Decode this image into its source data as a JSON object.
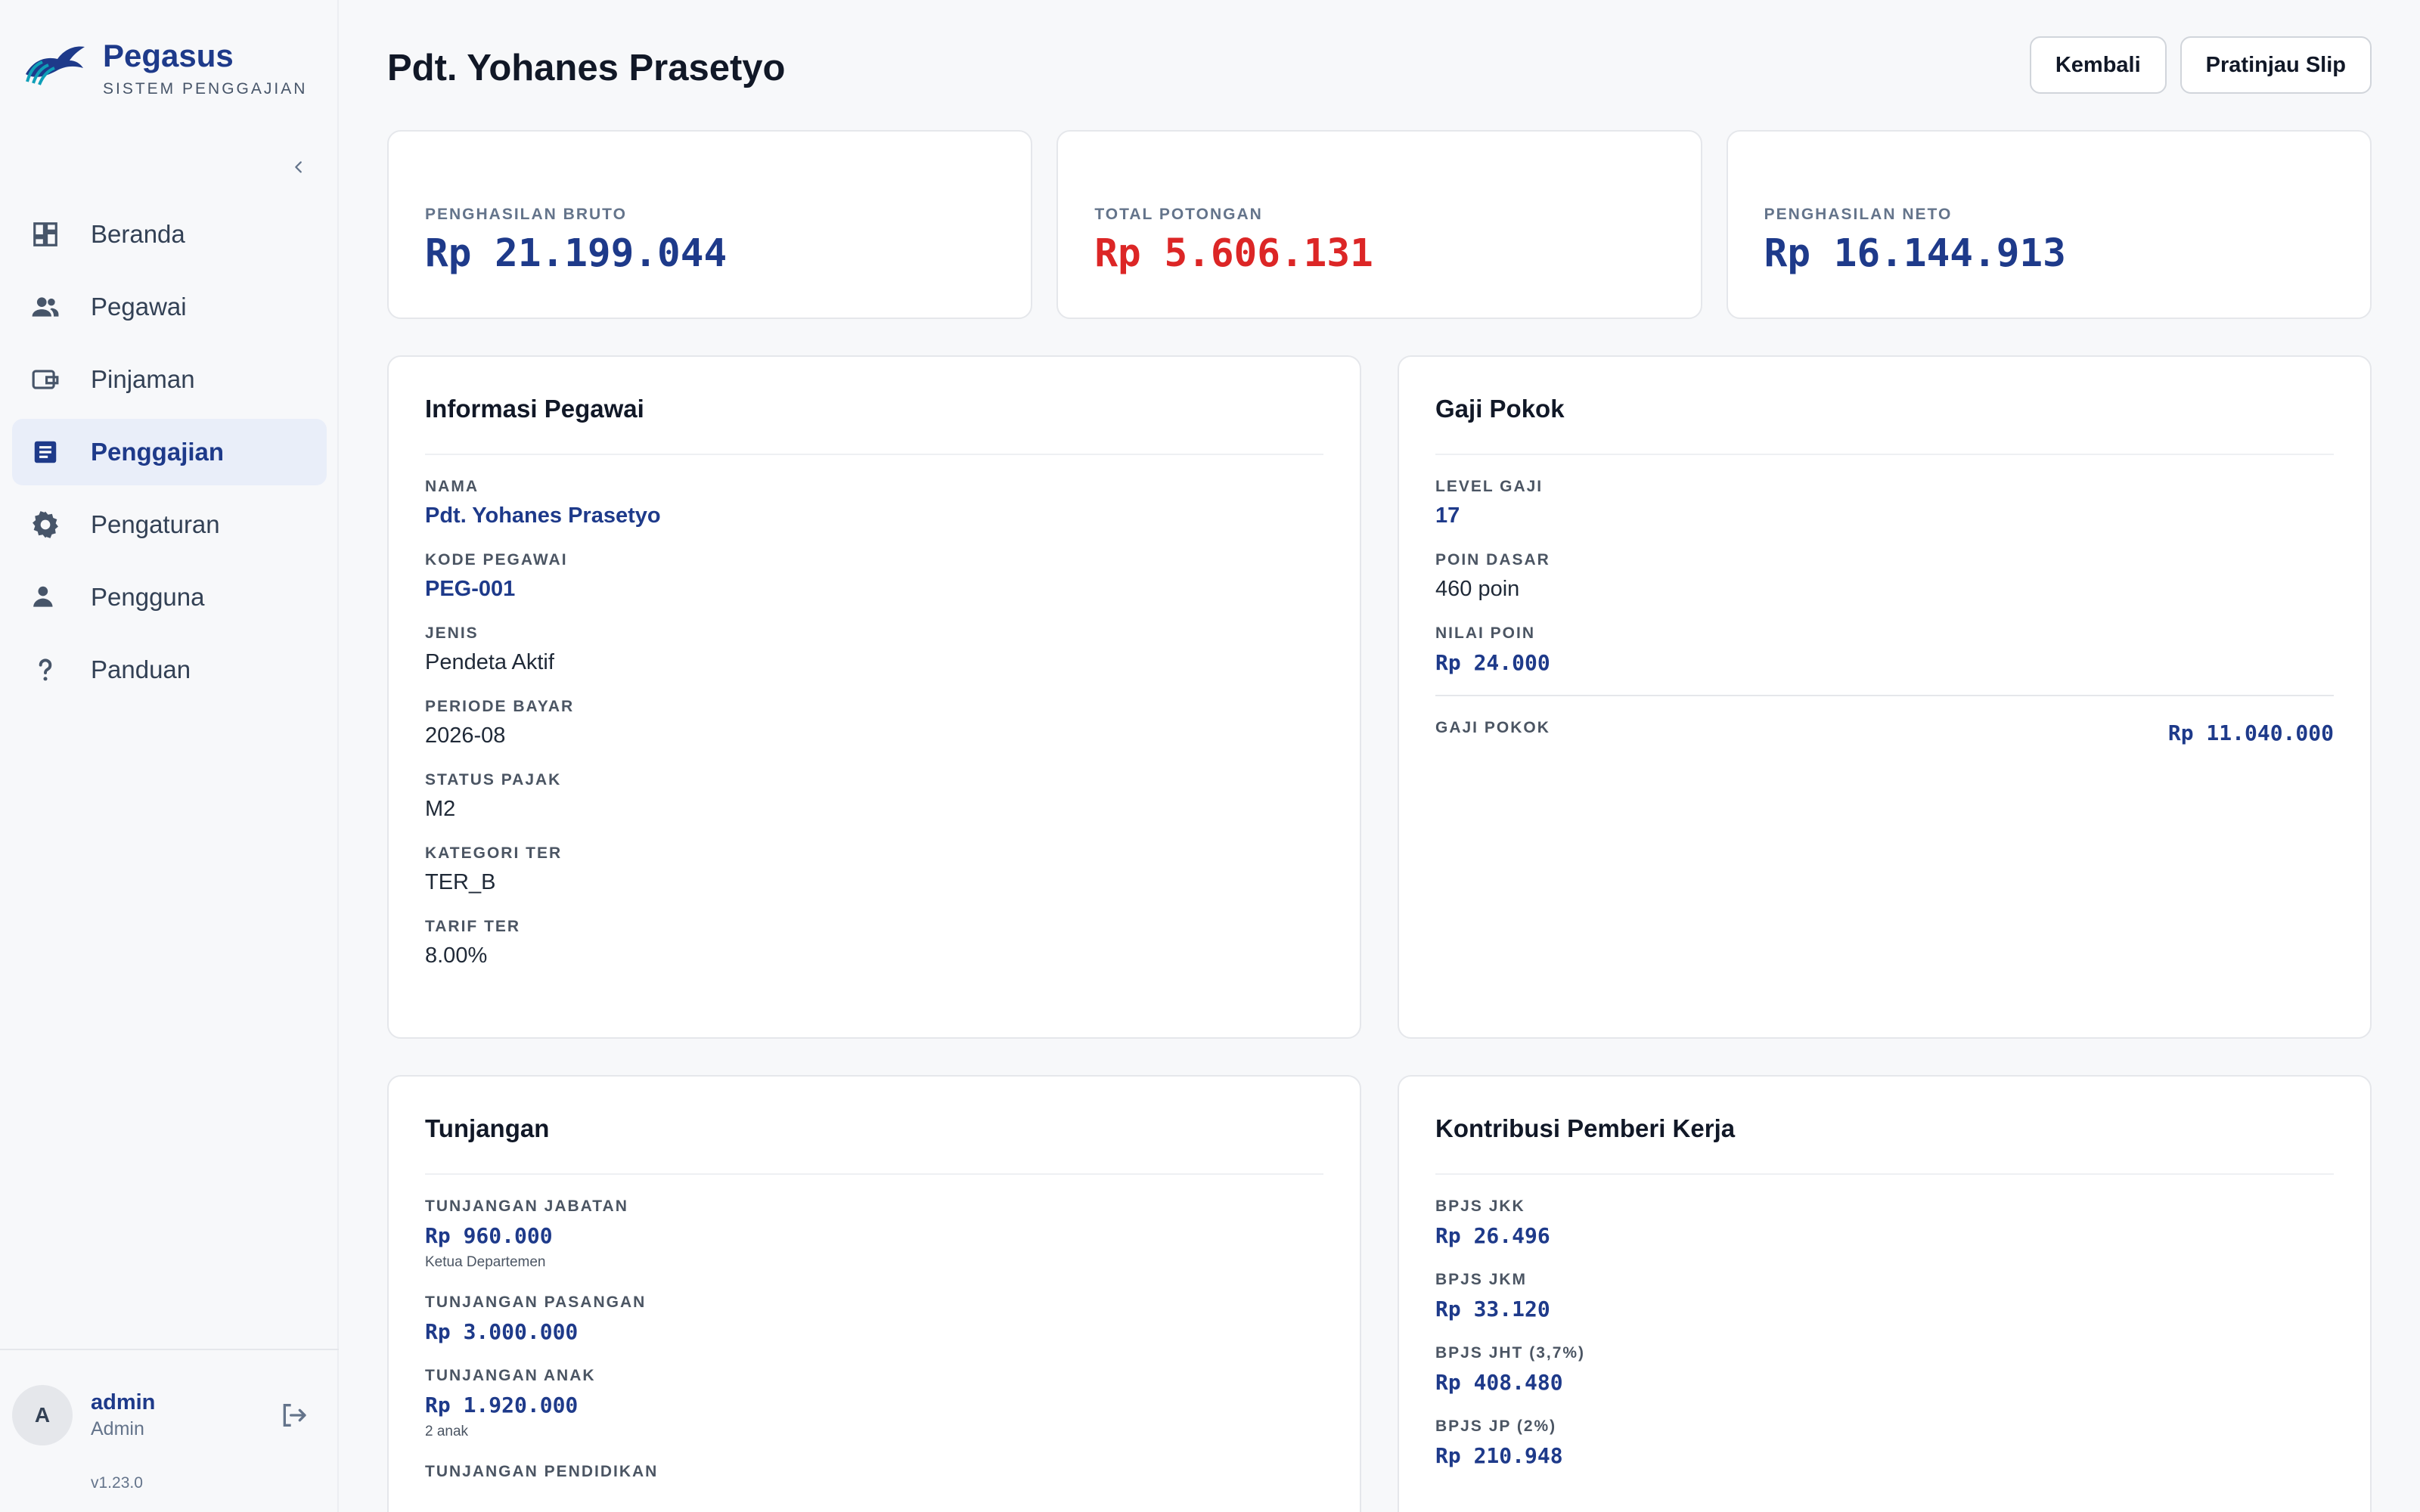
{
  "brand": {
    "name": "Pegasus",
    "subtitle": "SISTEM PENGGAJIAN"
  },
  "sidebar": {
    "items": [
      {
        "label": "Beranda",
        "icon": "dashboard-icon"
      },
      {
        "label": "Pegawai",
        "icon": "users-icon"
      },
      {
        "label": "Pinjaman",
        "icon": "wallet-icon"
      },
      {
        "label": "Penggajian",
        "icon": "receipt-icon",
        "active": true
      },
      {
        "label": "Pengaturan",
        "icon": "gear-icon"
      },
      {
        "label": "Pengguna",
        "icon": "user-icon"
      },
      {
        "label": "Panduan",
        "icon": "question-icon"
      }
    ],
    "user": {
      "initial": "A",
      "name": "admin",
      "role": "Admin"
    },
    "version": "v1.23.0"
  },
  "header": {
    "title": "Pdt. Yohanes Prasetyo",
    "back_label": "Kembali",
    "preview_label": "Pratinjau Slip"
  },
  "stats": [
    {
      "label": "PENGHASILAN BRUTO",
      "value": "Rp 21.199.044",
      "color": "#1e3a8a"
    },
    {
      "label": "TOTAL POTONGAN",
      "value": "Rp 5.606.131",
      "color": "#dc2626"
    },
    {
      "label": "PENGHASILAN NETO",
      "value": "Rp 16.144.913",
      "color": "#1e3a8a"
    }
  ],
  "info": {
    "title": "Informasi Pegawai",
    "fields": [
      {
        "label": "NAMA",
        "value": "Pdt. Yohanes Prasetyo"
      },
      {
        "label": "KODE PEGAWAI",
        "value": "PEG-001"
      },
      {
        "label": "JENIS",
        "value": "Pendeta Aktif"
      },
      {
        "label": "PERIODE BAYAR",
        "value": "2026-08"
      },
      {
        "label": "STATUS PAJAK",
        "value": "M2"
      },
      {
        "label": "KATEGORI TER",
        "value": "TER_B"
      },
      {
        "label": "TARIF TER",
        "value": "8.00%"
      }
    ]
  },
  "gaji": {
    "title": "Gaji Pokok",
    "fields": [
      {
        "label": "LEVEL GAJI",
        "value": "17"
      },
      {
        "label": "POIN DASAR",
        "value": "460 poin"
      },
      {
        "label": "NILAI POIN",
        "value": "Rp 24.000"
      }
    ],
    "total_label": "GAJI POKOK",
    "total_value": "Rp 11.040.000"
  },
  "tunjangan": {
    "title": "Tunjangan",
    "fields": [
      {
        "label": "TUNJANGAN JABATAN",
        "value": "Rp 960.000",
        "note": "Ketua Departemen"
      },
      {
        "label": "TUNJANGAN PASANGAN",
        "value": "Rp 3.000.000"
      },
      {
        "label": "TUNJANGAN ANAK",
        "value": "Rp 1.920.000",
        "note": "2 anak"
      },
      {
        "label": "TUNJANGAN PENDIDIKAN"
      }
    ]
  },
  "kontribusi": {
    "title": "Kontribusi Pemberi Kerja",
    "fields": [
      {
        "label": "BPJS JKK",
        "value": "Rp 26.496"
      },
      {
        "label": "BPJS JKM",
        "value": "Rp 33.120"
      },
      {
        "label": "BPJS JHT (3,7%)",
        "value": "Rp 408.480"
      },
      {
        "label": "BPJS JP (2%)",
        "value": "Rp 210.948"
      }
    ]
  }
}
